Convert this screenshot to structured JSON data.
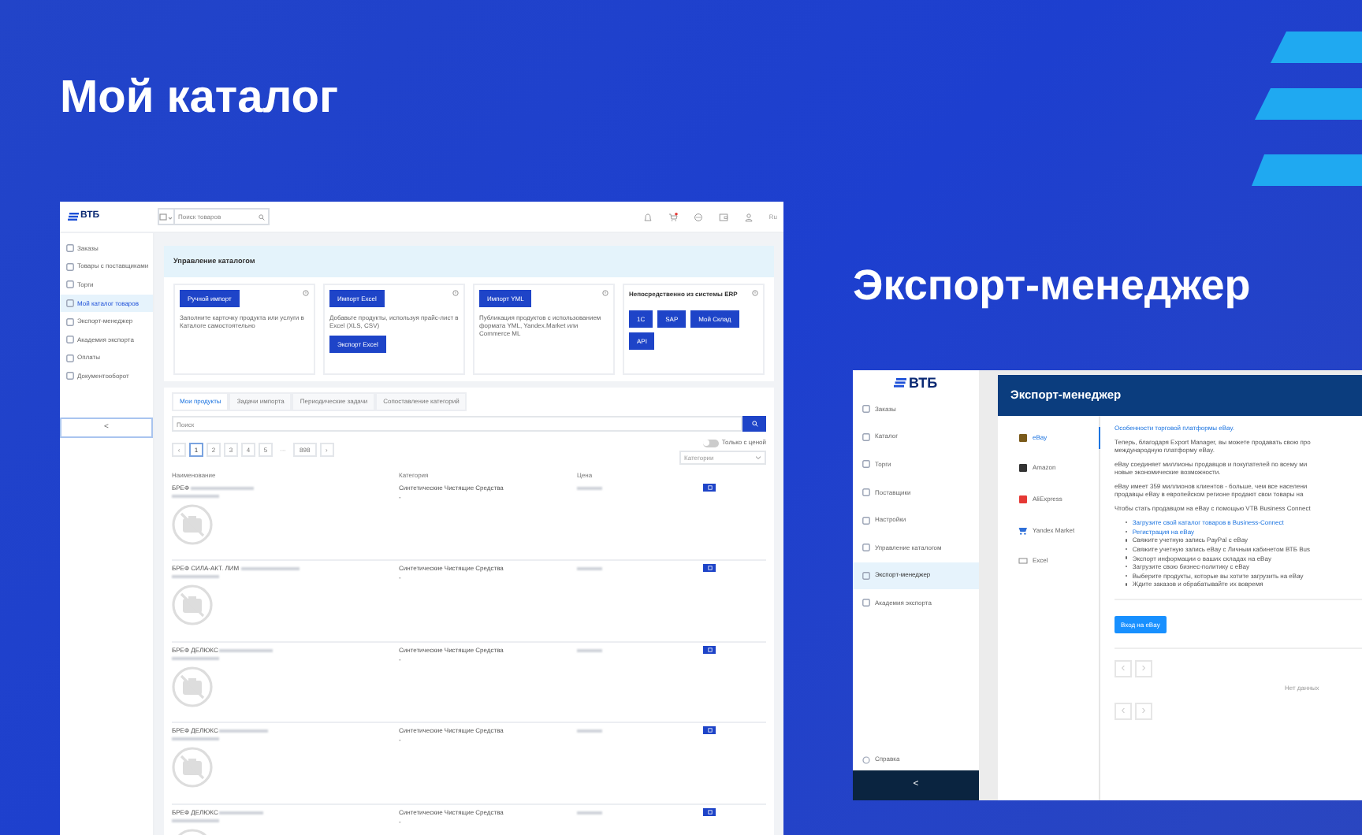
{
  "headline": "Мой каталог",
  "headline_2": "Экспорт-менеджер",
  "catalog_window": {
    "logo": "ВТБ",
    "search": {
      "placeholder": "Поиск товаров"
    },
    "language": "Ru",
    "sidebar": [
      {
        "label": "Заказы",
        "selected": false
      },
      {
        "label": "Товары с поставщиками",
        "selected": false
      },
      {
        "label": "Торги",
        "selected": false
      },
      {
        "label": "Мой каталог товаров",
        "selected": true
      },
      {
        "label": "Экспорт-менеджер",
        "selected": false
      },
      {
        "label": "Академия экспорта",
        "selected": false
      },
      {
        "label": "Оплаты",
        "selected": false
      },
      {
        "label": "Документооборот",
        "selected": false
      }
    ],
    "collapse": "<",
    "panel_title": "Управление каталогом",
    "cards": [
      {
        "kind": "import",
        "button": "Ручной импорт",
        "text": "Заполните карточку продукта или услуги в Каталоге самостоятельно"
      },
      {
        "kind": "import",
        "button": "Импорт Excel",
        "text": "Добавьте продукты, используя прайс-лист в Excel (XLS, CSV)",
        "button_2": "Экспорт Excel"
      },
      {
        "kind": "import",
        "button": "Импорт YML",
        "text": "Публикация продуктов с использованием формата YML, Yandex.Market или Commerce ML"
      },
      {
        "kind": "erp",
        "title": "Непосредственно из системы ERP",
        "buttons": [
          "1С",
          "SAP",
          "Мой Склад",
          "API"
        ]
      }
    ],
    "tabs": [
      {
        "label": "Мои продукты",
        "selected": true
      },
      {
        "label": "Задачи импорта",
        "selected": false
      },
      {
        "label": "Периодические задачи",
        "selected": false
      },
      {
        "label": "Сопоставление категорий",
        "selected": false
      }
    ],
    "product_search": {
      "placeholder": "Поиск"
    },
    "pages": [
      {
        "label": "‹",
        "kind": "arrow"
      },
      {
        "label": "1",
        "kind": "page",
        "selected": true
      },
      {
        "label": "2",
        "kind": "page",
        "selected": false
      },
      {
        "label": "3",
        "kind": "page",
        "selected": false
      },
      {
        "label": "4",
        "kind": "page",
        "selected": false
      },
      {
        "label": "5",
        "kind": "page",
        "selected": false
      },
      {
        "label": "···",
        "kind": "gap"
      },
      {
        "label": "898",
        "kind": "page",
        "selected": false
      },
      {
        "label": "›",
        "kind": "arrow"
      }
    ],
    "price_toggle": {
      "label": "Только с ценой",
      "on": false
    },
    "category_select": {
      "placeholder": "Категории"
    },
    "columns": [
      "Наименование",
      "Категория",
      "Цена"
    ],
    "rows": [
      {
        "name": "БРЕФ",
        "category": "Синтетические Чистящие Средства",
        "category_2": "-"
      },
      {
        "name": "БРЕФ СИЛА-АКТ. ЛИМ",
        "category": "Синтетические Чистящие Средства",
        "category_2": "-"
      },
      {
        "name": "БРЕФ ДЕЛЮКС",
        "category": "Синтетические Чистящие Средства",
        "category_2": "-"
      },
      {
        "name": "БРЕФ ДЕЛЮКС",
        "category": "Синтетические Чистящие Средства",
        "category_2": "-"
      },
      {
        "name": "БРЕФ ДЕЛЮКС",
        "category": "Синтетические Чистящие Средства",
        "category_2": "-"
      }
    ]
  },
  "export_window": {
    "logo": "ВТБ",
    "sidebar": [
      {
        "label": "Заказы",
        "selected": false
      },
      {
        "label": "Каталог",
        "selected": false
      },
      {
        "label": "Торги",
        "selected": false
      },
      {
        "label": "Поставщики",
        "selected": false
      },
      {
        "label": "Настройки",
        "selected": false
      },
      {
        "label": "Управление каталогом",
        "selected": false
      },
      {
        "label": "Экспорт-менеджер",
        "selected": true
      },
      {
        "label": "Академия экспорта",
        "selected": false
      }
    ],
    "help": "Справка",
    "collapse": "<",
    "title": "Экспорт-менеджер",
    "platforms": [
      {
        "label": "eBay",
        "kind": "ebay",
        "selected": true
      },
      {
        "label": "Amazon",
        "kind": "amazon",
        "selected": false
      },
      {
        "label": "AliExpress",
        "kind": "aliexpress",
        "selected": false
      },
      {
        "label": "Yandex Market",
        "kind": "yandex",
        "selected": false
      },
      {
        "label": "Excel",
        "kind": "excel",
        "selected": false
      }
    ],
    "heading": "Особенности торговой платформы eBay.",
    "paragraphs": [
      [
        "Теперь, благодаря Export Manager, вы можете продавать свою про",
        "международную платформу eBay."
      ],
      [
        "eBay соединяет миллионы продавцов и покупателей по всему ми",
        "новые экономические возможности."
      ],
      [
        "eBay имеет 359 миллионов клиентов - больше, чем все населени",
        "продавцы eBay в европейском регионе продают свои товары на"
      ],
      [
        "Чтобы стать продавцом на eBay с помощью VTB Business Connect"
      ]
    ],
    "steps": [
      {
        "text": "Загрузите свой каталог товаров в Business-Connect",
        "link": true
      },
      {
        "text": "Регистрация на eBay",
        "link": true
      },
      {
        "text": "Свяжите учетную запись PayPal с eBay",
        "link": false
      },
      {
        "text": "Свяжите учетную запись eBay с Личным кабинетом ВТБ Bus",
        "link": false
      },
      {
        "text": "Экспорт информации о ваших складах на eBay",
        "link": false
      },
      {
        "text": "Загрузите свою бизнес-политику с eBay",
        "link": false
      },
      {
        "text": "Выберите продукты, которые вы хотите загрузить на eBay",
        "link": false
      },
      {
        "text": "Ждите заказов и обрабатывайте их вовремя",
        "link": false
      }
    ],
    "button": "Вход на eBay",
    "empty": "Нет данных"
  }
}
